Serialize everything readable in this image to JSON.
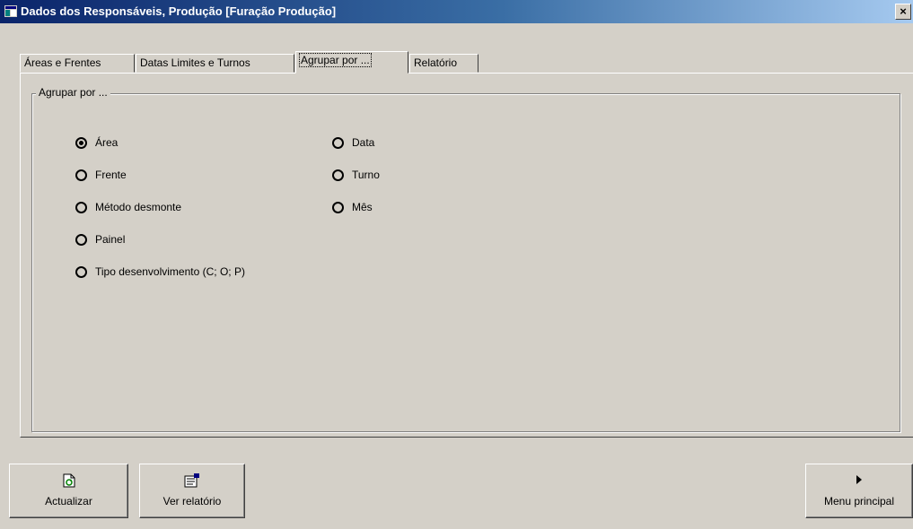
{
  "window": {
    "title": "Dados dos Responsáveis, Produção [Furação Produção]",
    "close_glyph": "×"
  },
  "tabs": [
    {
      "label": "Áreas e Frentes",
      "active": false
    },
    {
      "label": "Datas Limites e Turnos",
      "active": false
    },
    {
      "label": "Agrupar por ...",
      "active": true
    },
    {
      "label": "Relatório",
      "active": false
    }
  ],
  "group": {
    "legend": "Agrupar por ...",
    "options_left": [
      {
        "label": "Área",
        "checked": true
      },
      {
        "label": "Frente",
        "checked": false
      },
      {
        "label": "Método desmonte",
        "checked": false
      },
      {
        "label": "Painel",
        "checked": false
      },
      {
        "label": "Tipo desenvolvimento (C; O; P)",
        "checked": false
      }
    ],
    "options_right": [
      {
        "label": "Data",
        "checked": false
      },
      {
        "label": "Turno",
        "checked": false
      },
      {
        "label": "Mês",
        "checked": false
      }
    ]
  },
  "buttons": {
    "refresh": {
      "label": "Actualizar",
      "icon": "refresh-icon"
    },
    "report": {
      "label": "Ver relatório",
      "icon": "report-icon"
    },
    "main_menu": {
      "label": "Menu principal",
      "icon": "play-arrow-icon"
    }
  },
  "colors": {
    "face": "#d4d0c8",
    "title_start": "#0a246a",
    "title_end": "#a6caf0"
  }
}
